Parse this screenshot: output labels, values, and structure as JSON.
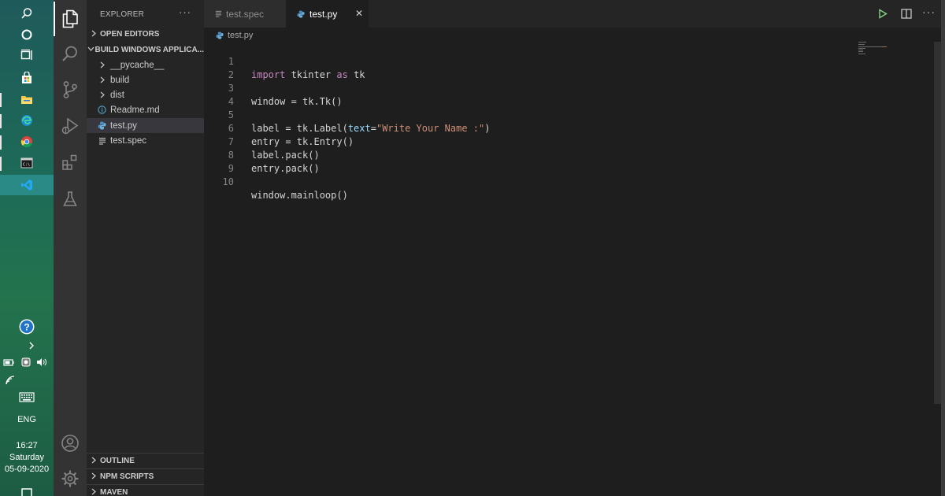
{
  "taskbar": {
    "clock_time": "16:27",
    "clock_day": "Saturday",
    "clock_date": "05-09-2020",
    "language": "ENG",
    "icons": [
      "search-icon",
      "cortana-icon",
      "task-view-icon",
      "store-icon",
      "file-explorer-icon",
      "edge-icon",
      "chrome-icon",
      "terminal-icon",
      "vscode-icon",
      "help-icon",
      "show-hidden-icons",
      "battery-icon",
      "network-icon",
      "volume-icon",
      "wifi-icon",
      "keyboard-icon",
      "notification-icon"
    ],
    "colors": {
      "active": "#2a8a86"
    }
  },
  "activity_bar": {
    "icons": [
      "explorer-icon",
      "search-icon",
      "source-control-icon",
      "run-debug-icon",
      "extensions-icon",
      "testing-icon",
      "account-icon",
      "settings-gear-icon"
    ]
  },
  "sidebar": {
    "title": "EXPLORER",
    "more_actions": "···",
    "open_editors_label": "OPEN EDITORS",
    "folder_label": "BUILD WINDOWS APPLICA...",
    "items": [
      {
        "label": "__pycache__",
        "kind": "folder"
      },
      {
        "label": "build",
        "kind": "folder"
      },
      {
        "label": "dist",
        "kind": "folder"
      },
      {
        "label": "Readme.md",
        "kind": "info-file"
      },
      {
        "label": "test.py",
        "kind": "python-file",
        "selected": true
      },
      {
        "label": "test.spec",
        "kind": "text-file"
      }
    ],
    "outline_label": "OUTLINE",
    "npm_label": "NPM SCRIPTS",
    "maven_label": "MAVEN"
  },
  "editor": {
    "tabs": [
      {
        "label": "test.spec",
        "active": false
      },
      {
        "label": "test.py",
        "active": true
      }
    ],
    "close_glyph": "✕",
    "breadcrumb": "test.py",
    "line_numbers": [
      "1",
      "2",
      "3",
      "4",
      "5",
      "6",
      "7",
      "8",
      "9",
      "10"
    ],
    "lines": {
      "l1": {
        "kw1": "import",
        "mod": " tkinter ",
        "kw2": "as",
        "alias": " tk"
      },
      "l3": {
        "text": "window = tk.Tk()"
      },
      "l5": {
        "pre": "label = tk.Label(",
        "param": "text",
        "eq": "=",
        "str": "\"Write Your Name :\"",
        "post": ")"
      },
      "l6": {
        "text": "entry = tk.Entry()"
      },
      "l7": {
        "text": "label.pack()"
      },
      "l8": {
        "text": "entry.pack()"
      },
      "l10": {
        "text": "window.mainloop()"
      }
    },
    "colors": {
      "keyword": "#c586c0",
      "string": "#ce9178",
      "variable": "#9cdcfe",
      "background": "#1e1e1e"
    }
  }
}
